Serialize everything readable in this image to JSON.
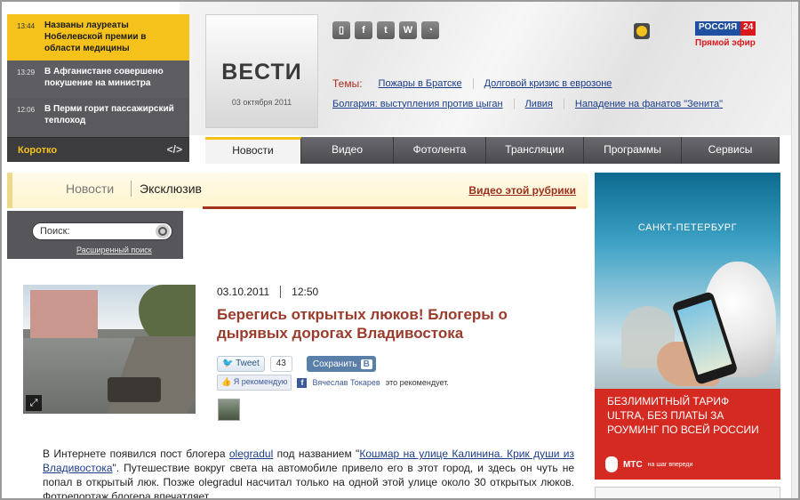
{
  "ticker": {
    "items": [
      {
        "time": "13:44",
        "text": "Названы лауреаты Нобелевской премии в области медицины"
      },
      {
        "time": "13:29",
        "text": "В Афганистане совершено покушение на министра"
      },
      {
        "time": "12:06",
        "text": "В Перми горит пассажирский теплоход"
      }
    ],
    "footer_label": "Коротко",
    "embed_code": "</>"
  },
  "logo": {
    "name": "ВЕСТИ",
    "date": "03 октября 2011"
  },
  "channel": {
    "left": "РОССИЯ",
    "right": "24",
    "live": "Прямой эфир"
  },
  "topics": {
    "label": "Темы:",
    "row1": [
      "Пожары в Братске",
      "Долговой кризис в еврозоне"
    ],
    "row2": [
      "Болгария: выступления против цыган",
      "Ливия",
      "Нападение на фанатов \"Зенита\""
    ]
  },
  "nav": {
    "tabs": [
      "Новости",
      "Видео",
      "Фотолента",
      "Трансляции",
      "Программы",
      "Сервисы"
    ]
  },
  "section": {
    "news": "Новости",
    "exclusive": "Эксклюзив",
    "video_link": "Видео этой рубрики"
  },
  "search": {
    "placeholder": "Поиск:",
    "advanced": "Расширенный поиск"
  },
  "article": {
    "date": "03.10.2011",
    "time": "12:50",
    "title": "Берегись открытых люков! Блогеры о дырявых дорогах Владивостока",
    "tweet_label": "Tweet",
    "tweet_count": "43",
    "save_label": "Сохранить",
    "vk_letter": "В",
    "fb_recommend": "Я рекомендую",
    "fb_name": "Вячеслав Токарев",
    "fb_suffix": "это рекомендует.",
    "body_1": "В Интернете появился пост блогера ",
    "body_link1": "olegradul",
    "body_2": " под названием \"",
    "body_link2": "Кошмар на улице Калинина. Крик души из Владивостока",
    "body_3": "\". Путешествие вокруг света на автомобиле привело его в этот город, и здесь он чуть не попал в открытый люк. Позже olegradul насчитал только на одной этой улице около 30 открытых люков. Фотрепортаж блогера впечатляет."
  },
  "ad": {
    "city": "САНКТ-ПЕТЕРБУРГ",
    "line1": "БЕЗЛИМИТНЫЙ ТАРИФ",
    "line2": "ULTRA, БЕЗ ПЛАТЫ ЗА",
    "line3": "РОУМИНГ ПО ВСЕЙ РОССИИ",
    "brand": "МТС",
    "slogan": "на шаг впереди"
  }
}
